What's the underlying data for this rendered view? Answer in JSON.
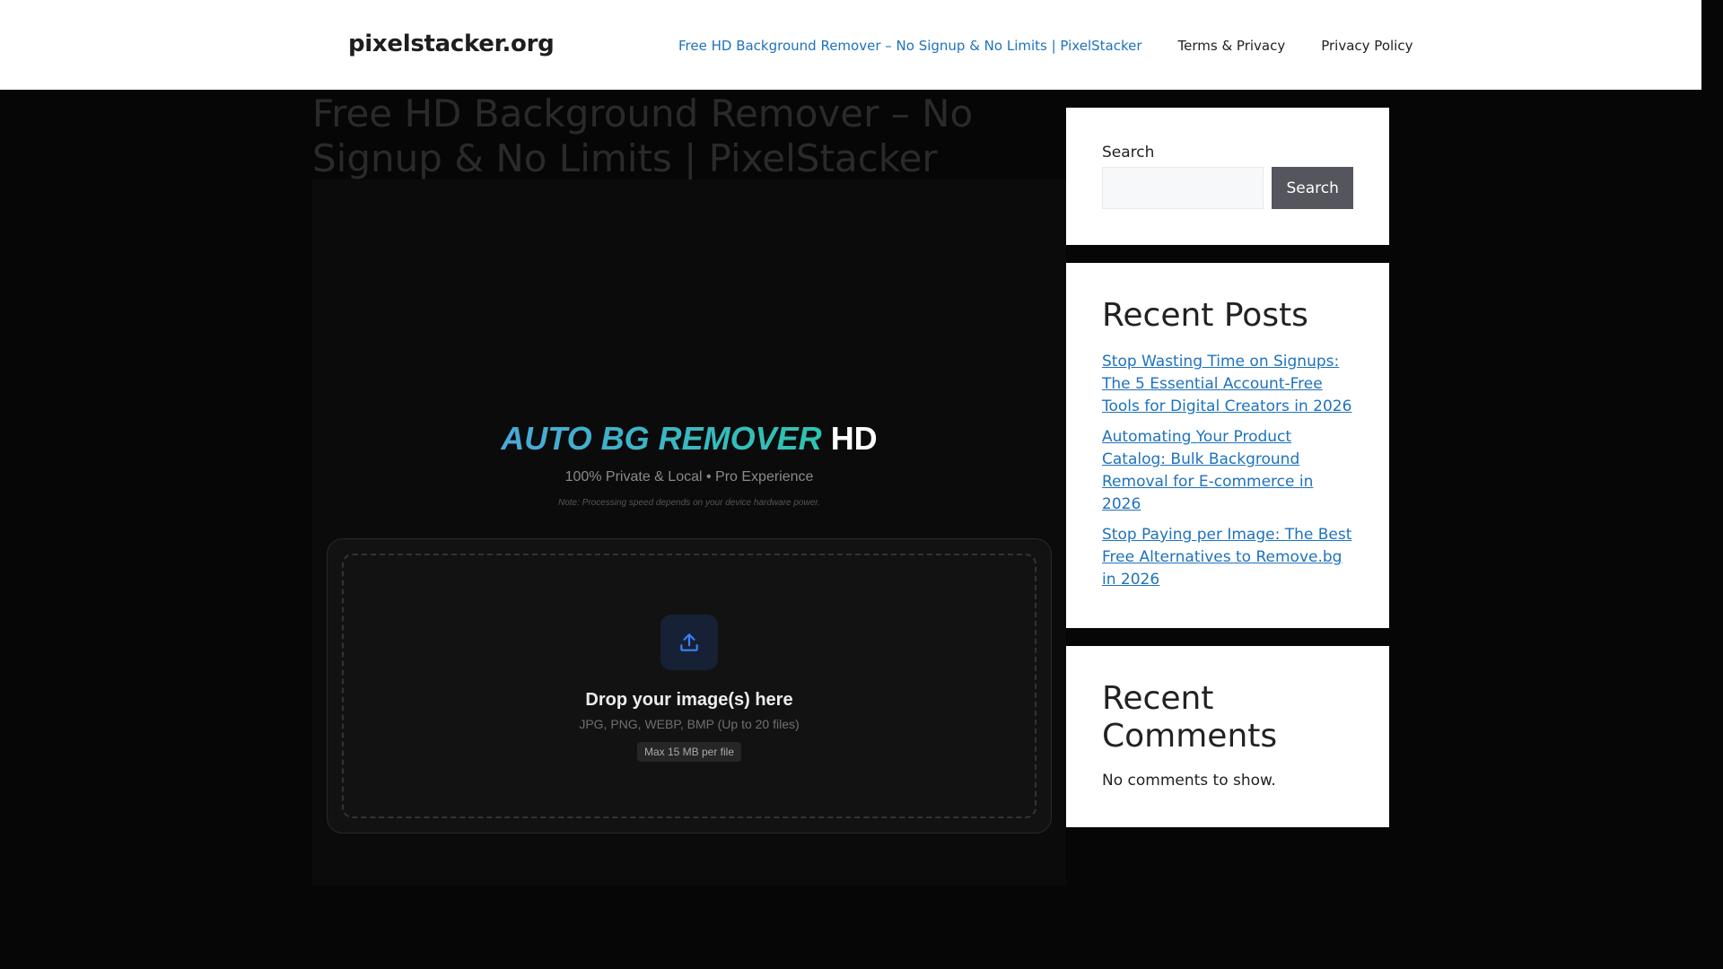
{
  "header": {
    "site_title": "pixelstacker.org",
    "nav": [
      {
        "label": "Free HD Background Remover – No Signup & No Limits | PixelStacker",
        "current": true
      },
      {
        "label": "Terms & Privacy",
        "current": false
      },
      {
        "label": "Privacy Policy",
        "current": false
      }
    ]
  },
  "page": {
    "title": "Free HD Background Remover – No Signup & No Limits | PixelStacker"
  },
  "app": {
    "brand_main": "AUTO BG REMOVER",
    "brand_suffix": "HD",
    "tagline": "100% Private & Local • Pro Experience",
    "note": "Note: Processing speed depends on your device hardware power.",
    "upload_icon": "upload-icon",
    "drop_title": "Drop your image(s) here",
    "drop_types": "JPG, PNG, WEBP, BMP (Up to 20 files)",
    "max_size": "Max 15 MB per file"
  },
  "sidebar": {
    "search": {
      "label": "Search",
      "button": "Search",
      "value": ""
    },
    "recent_posts": {
      "title": "Recent Posts",
      "items": [
        "Stop Wasting Time on Signups: The 5 Essential Account-Free Tools for Digital Creators in 2026",
        "Automating Your Product Catalog: Bulk Background Removal for E-commerce in 2026",
        "Stop Paying per Image: The Best Free Alternatives to Remove.bg in 2026"
      ]
    },
    "recent_comments": {
      "title": "Recent Comments",
      "empty_text": "No comments to show."
    }
  },
  "colors": {
    "link": "#1e72bd",
    "brand_gradient_start": "#4aa8d8",
    "brand_gradient_end": "#2dc4b0",
    "page_bg": "#060606"
  }
}
